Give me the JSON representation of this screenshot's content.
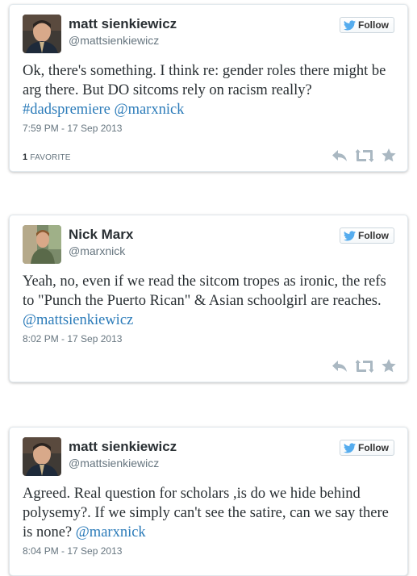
{
  "colors": {
    "link": "#2b7bb9",
    "text": "#292f33",
    "meta": "#66757f",
    "twitter_bird": "#55acee",
    "action_icon": "#aab8c2"
  },
  "tweets": [
    {
      "name": "matt sienkiewicz",
      "handle": "@mattsienkiewicz",
      "follow_label": "Follow",
      "text_plain": "Ok, there's something. I think re: gender roles there might be arg there. But DO sitcoms rely on racism really?",
      "hashtag": "#dadspremiere",
      "mention": "@marxnick",
      "timestamp": "7:59 PM - 17 Sep 2013",
      "favorite_count": "1",
      "favorite_label": "FAVORITE"
    },
    {
      "name": "Nick Marx",
      "handle": "@marxnick",
      "follow_label": "Follow",
      "text_plain": "Yeah, no, even if we read the sitcom tropes as ironic, the refs to \"Punch the Puerto Rican\" & Asian schoolgirl are reaches.",
      "mention": "@mattsienkiewicz",
      "timestamp": "8:02 PM - 17 Sep 2013"
    },
    {
      "name": "matt sienkiewicz",
      "handle": "@mattsienkiewicz",
      "follow_label": "Follow",
      "text_plain": "Agreed. Real question for scholars ,is do we hide behind polysemy?. If we simply can't see the satire, can we say there is none?",
      "mention": "@marxnick",
      "timestamp": "8:04 PM - 17 Sep 2013"
    }
  ]
}
